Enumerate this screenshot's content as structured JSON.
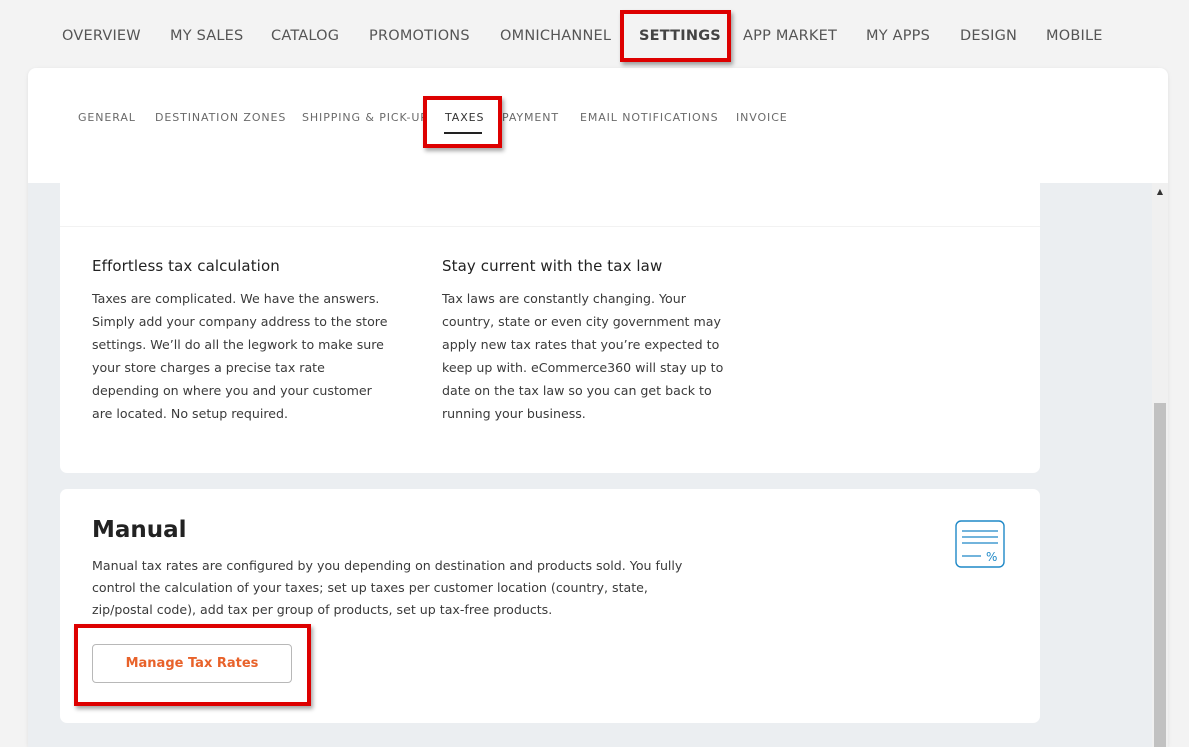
{
  "top_nav": {
    "items": [
      {
        "label": "OVERVIEW"
      },
      {
        "label": "MY SALES"
      },
      {
        "label": "CATALOG"
      },
      {
        "label": "PROMOTIONS"
      },
      {
        "label": "OMNICHANNEL"
      },
      {
        "label": "SETTINGS"
      },
      {
        "label": "APP MARKET"
      },
      {
        "label": "MY APPS"
      },
      {
        "label": "DESIGN"
      },
      {
        "label": "MOBILE"
      }
    ],
    "active": "SETTINGS"
  },
  "sub_nav": {
    "tabs": [
      {
        "label": "GENERAL"
      },
      {
        "label": "DESTINATION ZONES"
      },
      {
        "label": "SHIPPING & PICK-UP"
      },
      {
        "label": "TAXES"
      },
      {
        "label": "PAYMENT"
      },
      {
        "label": "EMAIL NOTIFICATIONS"
      },
      {
        "label": "INVOICE"
      }
    ],
    "active": "TAXES"
  },
  "info_card": {
    "left": {
      "title": "Effortless tax calculation",
      "text": "Taxes are complicated. We have the answers. Simply add your company address to the store settings. We’ll do all the legwork to make sure your store charges a precise tax rate depending on where you and your customer are located. No setup required."
    },
    "right": {
      "title": "Stay current with the tax law",
      "text": "Tax laws are constantly changing. Your country, state or even city government may apply new tax rates that you’re expected to keep up with. eCommerce360 will stay up to date on the tax law so you can get back to running your business."
    }
  },
  "manual_card": {
    "title": "Manual",
    "description": "Manual tax rates are configured by you depending on destination and products sold. You fully control the calculation of your taxes; set up taxes per customer location (country, state, zip/postal code), add tax per group of products, set up tax-free products.",
    "button_label": "Manage Tax Rates",
    "icon": "tax-document-percent-icon"
  },
  "colors": {
    "accent": "#e8622a",
    "highlight": "#dd0000",
    "icon_blue": "#1e88c7",
    "panel_bg": "#ebeef1"
  }
}
